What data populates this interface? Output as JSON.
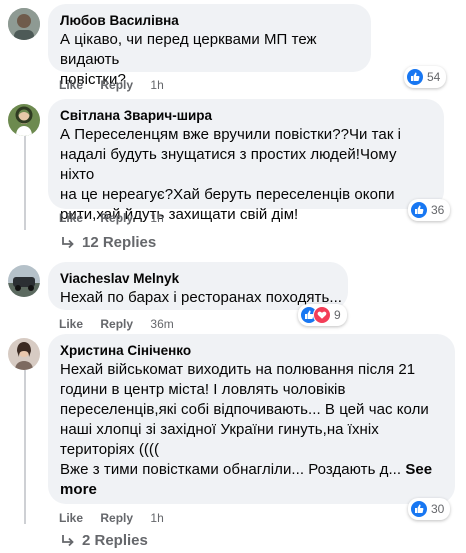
{
  "comments": [
    {
      "author": "Любов Василівна",
      "text": "А цікаво, чи перед церквами МП теж видають\nповістки?",
      "like": "Like",
      "reply": "Reply",
      "time": "1h",
      "reactions": {
        "count": "54",
        "types": [
          "like-icon"
        ]
      }
    },
    {
      "author": "Світлана Зварич-шира",
      "text": "А Переселенцям вже вручили повістки??Чи так і\nнадалі будуть знущатися з простих людей!Чому ніхто\nна це нереагує?Хай беруть переселенців окопи\nрити,хай йдуть захищати свій дім!",
      "like": "Like",
      "reply": "Reply",
      "time": "1h",
      "reactions": {
        "count": "36",
        "types": [
          "like-icon"
        ]
      },
      "replies_label": "12 Replies"
    },
    {
      "author": "Viacheslav Melnyk",
      "text": "Нехай по барах і ресторанах походять...",
      "like": "Like",
      "reply": "Reply",
      "time": "36m",
      "reactions": {
        "count": "9",
        "types": [
          "like-icon",
          "love-icon"
        ]
      }
    },
    {
      "author": "Христина Сініченко",
      "text": "Нехай військомат виходить на полювання після 21\nгодини в центр міста! І ловлять чоловіків\nпереселенців,які собі відпочивають... В цей час коли\nнаші хлопці зі західної України гинуть,на їхніх\nтериторіях ((((\nВже з тими повістками обнагліли... Роздають д...",
      "see_more": "See\nmore",
      "like": "Like",
      "reply": "Reply",
      "time": "1h",
      "reactions": {
        "count": "30",
        "types": [
          "like-icon"
        ]
      },
      "replies_label": "2 Replies"
    }
  ],
  "colors": {
    "like": "#1877f2",
    "love": "#f33e58",
    "bubble": "#f0f2f5",
    "meta": "#65676b"
  }
}
